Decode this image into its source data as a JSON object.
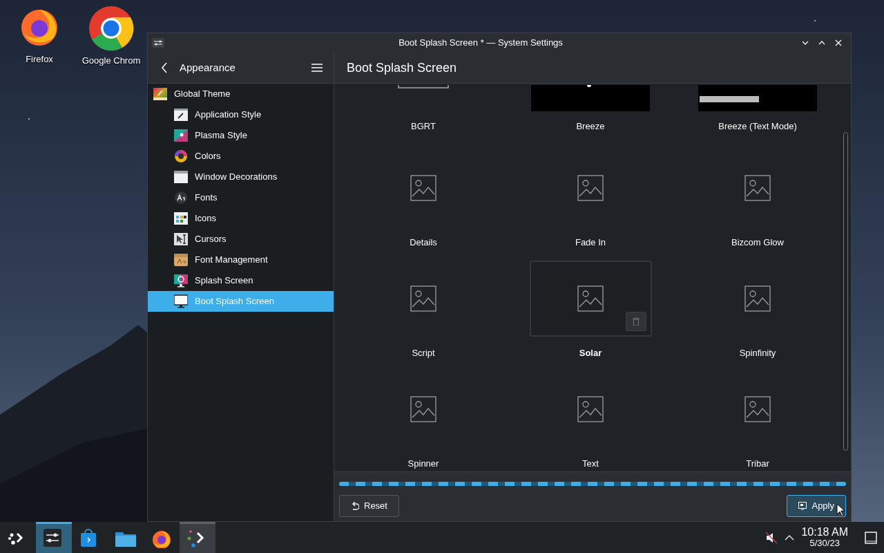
{
  "desktop": {
    "icons": [
      {
        "label": "Firefox",
        "kind": "firefox"
      },
      {
        "label": "Google Chrom",
        "kind": "chrome"
      }
    ]
  },
  "window": {
    "title": "Boot Splash Screen * — System Settings"
  },
  "sidebar": {
    "header": "Appearance",
    "items": [
      {
        "label": "Global Theme",
        "selected": false,
        "children": [
          {
            "label": "Application Style",
            "selected": false
          },
          {
            "label": "Plasma Style",
            "selected": false
          },
          {
            "label": "Colors",
            "selected": false
          },
          {
            "label": "Window Decorations",
            "selected": false
          },
          {
            "label": "Fonts",
            "selected": false
          },
          {
            "label": "Icons",
            "selected": false
          },
          {
            "label": "Cursors",
            "selected": false
          },
          {
            "label": "Font Management",
            "selected": false
          },
          {
            "label": "Splash Screen",
            "selected": false
          },
          {
            "label": "Boot Splash Screen",
            "selected": true
          }
        ]
      }
    ]
  },
  "page": {
    "title": "Boot Splash Screen",
    "themes": [
      {
        "label": "BGRT",
        "kind": "bgrt",
        "selected": false
      },
      {
        "label": "Breeze",
        "kind": "breeze",
        "selected": false
      },
      {
        "label": "Breeze (Text Mode)",
        "kind": "textmode",
        "selected": false
      },
      {
        "label": "Details",
        "kind": "placeholder",
        "selected": false
      },
      {
        "label": "Fade In",
        "kind": "placeholder",
        "selected": false
      },
      {
        "label": "Bizcom Glow",
        "kind": "placeholder",
        "selected": false
      },
      {
        "label": "Script",
        "kind": "placeholder",
        "selected": false
      },
      {
        "label": "Solar",
        "kind": "placeholder",
        "selected": true
      },
      {
        "label": "Spinfinity",
        "kind": "placeholder",
        "selected": false
      },
      {
        "label": "Spinner",
        "kind": "placeholder",
        "selected": false
      },
      {
        "label": "Text",
        "kind": "placeholder",
        "selected": false
      },
      {
        "label": "Tribar",
        "kind": "placeholder",
        "selected": false
      }
    ]
  },
  "footer": {
    "buttons": [
      {
        "label": "Reset",
        "kind": "reset",
        "hovered": false
      },
      {
        "label": "Apply",
        "kind": "apply",
        "hovered": true
      }
    ]
  },
  "taskbar": {
    "apps": [
      {
        "kind": "launcher",
        "selected": false,
        "hovered": false
      },
      {
        "kind": "settings",
        "selected": true,
        "hovered": false
      },
      {
        "kind": "store",
        "selected": false,
        "hovered": false
      },
      {
        "kind": "files",
        "selected": false,
        "hovered": false
      },
      {
        "kind": "firefox",
        "selected": false,
        "hovered": false
      },
      {
        "kind": "terminal",
        "selected": false,
        "hovered": true
      }
    ],
    "clock": {
      "time": "10:18 AM",
      "date": "5/30/23"
    }
  }
}
